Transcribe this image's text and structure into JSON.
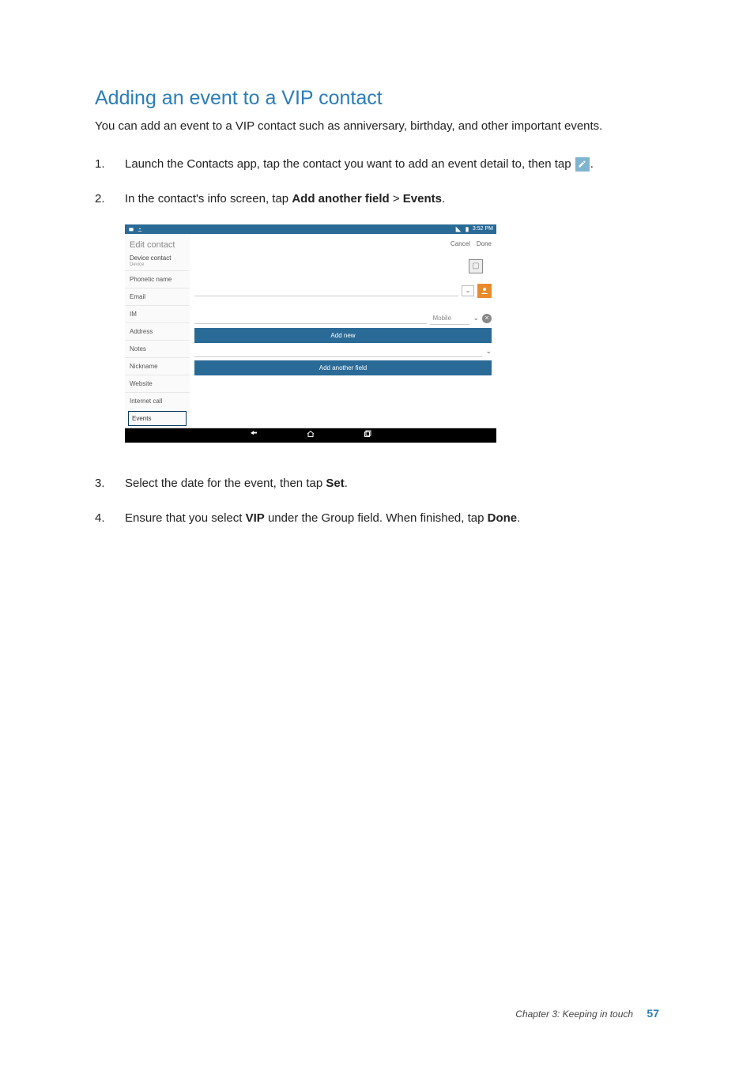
{
  "heading": "Adding an event to a VIP contact",
  "intro": "You can add an event to a VIP contact such as anniversary, birthday, and other important events.",
  "steps": {
    "s1": {
      "num": "1.",
      "pre": "Launch the Contacts app, tap the contact you want to add an event detail to, then tap ",
      "post": "."
    },
    "s2": {
      "num": "2.",
      "pre": "In the contact's info screen, tap ",
      "b1": "Add another field",
      "mid": " > ",
      "b2": "Events",
      "post": "."
    },
    "s3": {
      "num": "3.",
      "pre": "Select the date for the event, then tap ",
      "b1": "Set",
      "post": "."
    },
    "s4": {
      "num": "4.",
      "pre": "Ensure that you select ",
      "b1": "VIP",
      "mid": " under the Group field. When finished, tap ",
      "b2": "Done",
      "post": "."
    }
  },
  "screenshot": {
    "status_time": "3:52 PM",
    "sidebar_header": "Edit contact",
    "account_label": "Device contact",
    "account_sub": "Device",
    "items": [
      "Phonetic name",
      "Email",
      "IM",
      "Address",
      "Notes",
      "Nickname",
      "Website",
      "Internet call",
      "Events"
    ],
    "top_actions": {
      "cancel": "Cancel",
      "done": "Done"
    },
    "phone_type": "Mobile",
    "add_new": "Add new",
    "add_another": "Add another field"
  },
  "footer": {
    "chapter": "Chapter 3: Keeping in touch",
    "page": "57"
  }
}
